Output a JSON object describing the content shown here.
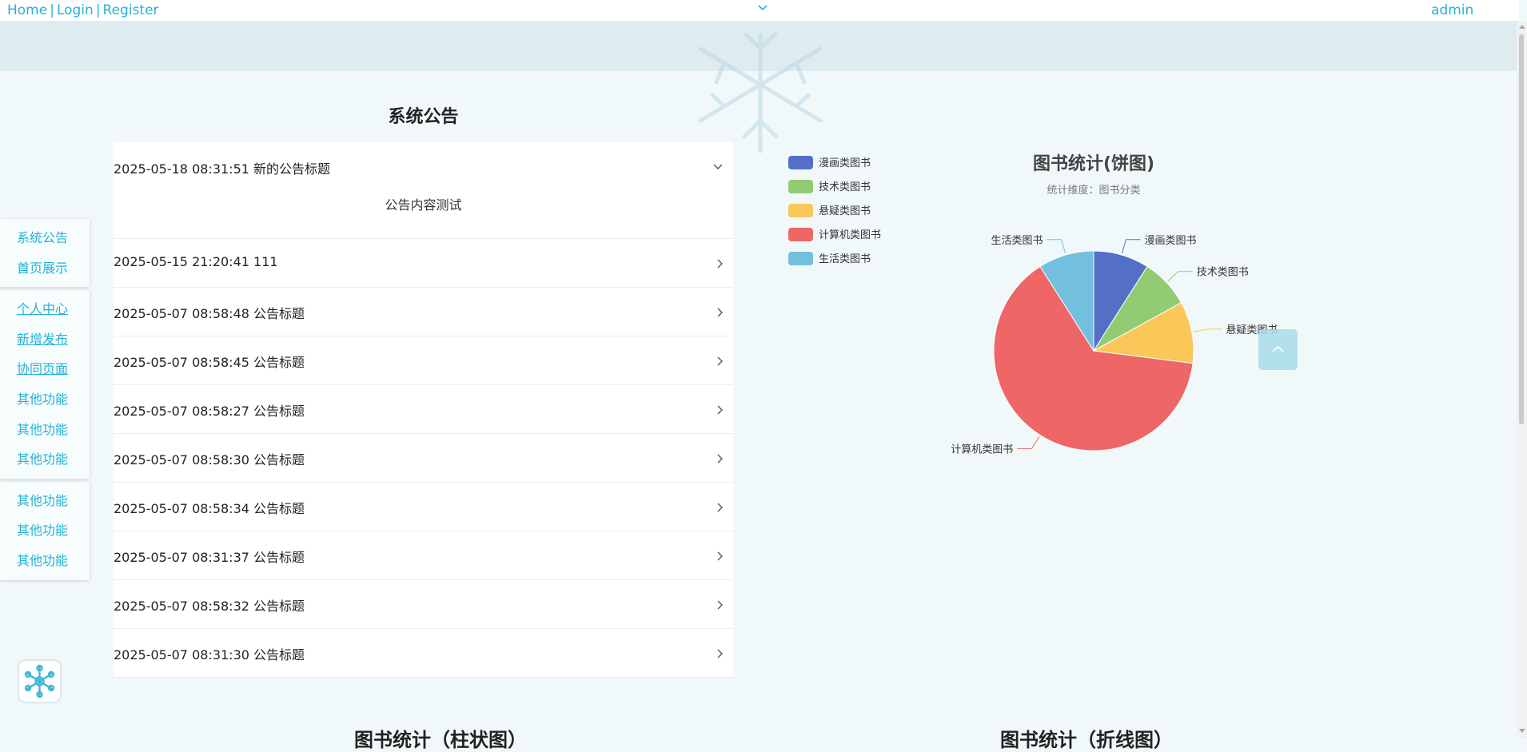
{
  "topbar": {
    "nav": [
      "Home",
      "Login",
      "Register"
    ],
    "user": "admin",
    "dropdown_icon": "chevron-down-icon"
  },
  "sidebar": {
    "groups": [
      [
        "系统公告",
        "首页展示"
      ],
      [
        "个人中心",
        "新增发布",
        "协同页面",
        "其他功能",
        "其他功能",
        "其他功能"
      ],
      [
        "其他功能",
        "其他功能",
        "其他功能"
      ]
    ]
  },
  "notice": {
    "title": "系统公告",
    "items": [
      {
        "text": "2025-05-18 08:31:51 新的公告标题",
        "expanded": true,
        "content": "公告内容测试"
      },
      {
        "text": "2025-05-15 21:20:41 111"
      },
      {
        "text": "2025-05-07 08:58:48 公告标题"
      },
      {
        "text": "2025-05-07 08:58:45 公告标题"
      },
      {
        "text": "2025-05-07 08:58:27 公告标题"
      },
      {
        "text": "2025-05-07 08:58:30 公告标题"
      },
      {
        "text": "2025-05-07 08:58:34 公告标题"
      },
      {
        "text": "2025-05-07 08:31:37 公告标题"
      },
      {
        "text": "2025-05-07 08:58:32 公告标题"
      },
      {
        "text": "2025-05-07 08:31:30 公告标题"
      }
    ]
  },
  "chart_data": {
    "type": "pie",
    "title": "图书统计(饼图)",
    "subtitle": "统计维度：图书分类",
    "legend_position": "top-left",
    "slices": [
      {
        "name": "漫画类图书",
        "value": 9,
        "color": "#5470c6"
      },
      {
        "name": "技术类图书",
        "value": 8,
        "color": "#91cc75"
      },
      {
        "name": "悬疑类图书",
        "value": 10,
        "color": "#fac858"
      },
      {
        "name": "计算机类图书",
        "value": 64,
        "color": "#ee6666"
      },
      {
        "name": "生活类图书",
        "value": 9,
        "color": "#73c0de"
      }
    ]
  },
  "sections": {
    "bar_chart_title": "图书统计（柱状图）",
    "line_chart_title": "图书统计（折线图）"
  },
  "icons": {
    "back_to_top": "chevron-up-icon",
    "logo": "snowflake-logo-icon",
    "row_arrow": "chevron-right-icon",
    "row_expanded": "chevron-down-icon"
  },
  "colors": {
    "accent": "#26b2d4",
    "page_bg": "#f1f8fa",
    "banner_bg": "#deecf0"
  }
}
